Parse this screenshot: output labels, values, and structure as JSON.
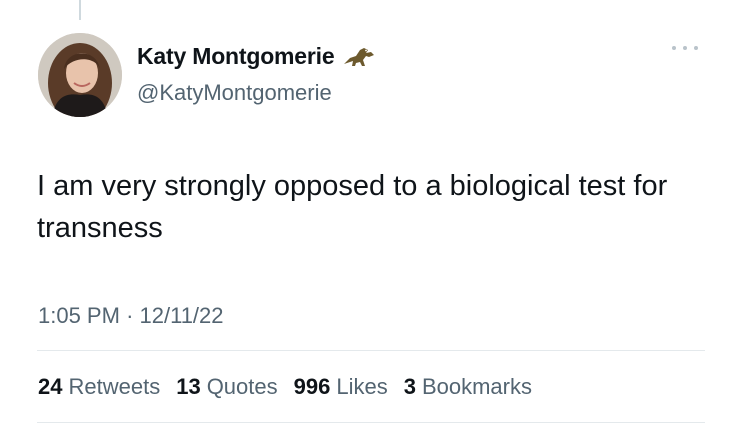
{
  "author": {
    "display_name": "Katy Montgomerie",
    "handle": "@KatyMontgomerie",
    "badge_icon": "trex-emoji-icon"
  },
  "tweet": {
    "text": "I am very strongly opposed to a biological test for transness",
    "time": "1:05 PM",
    "separator": "·",
    "date": "12/11/22"
  },
  "stats": [
    {
      "count": "24",
      "label": "Retweets"
    },
    {
      "count": "13",
      "label": "Quotes"
    },
    {
      "count": "996",
      "label": "Likes"
    },
    {
      "count": "3",
      "label": "Bookmarks"
    }
  ],
  "colors": {
    "primary_text": "#0f1419",
    "secondary_text": "#536471",
    "divider": "#e4e9ec"
  }
}
